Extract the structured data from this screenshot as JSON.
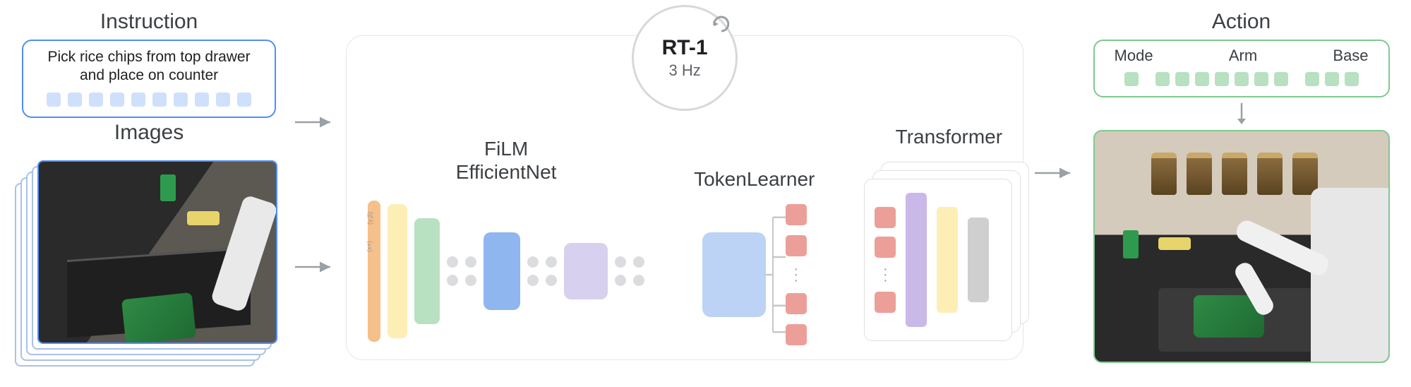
{
  "left": {
    "instruction_title": "Instruction",
    "instruction_text": "Pick rice chips from top drawer and place on counter",
    "images_title": "Images"
  },
  "center": {
    "badge_title": "RT-1",
    "badge_hz": "3 Hz",
    "module1_line1": "FiLM",
    "module1_line2": "EfficientNet",
    "module2": "TokenLearner",
    "module3": "Transformer",
    "film_gamma_beta": "(γ,β)",
    "film_xplus": "(x+)"
  },
  "right": {
    "action_title": "Action",
    "col_mode": "Mode",
    "col_arm": "Arm",
    "col_base": "Base"
  },
  "colors": {
    "blue_accent": "#4f8ef7",
    "green_accent": "#7fc98f",
    "token_blue": "#cfe0fb",
    "token_green": "#b7e1c0"
  }
}
